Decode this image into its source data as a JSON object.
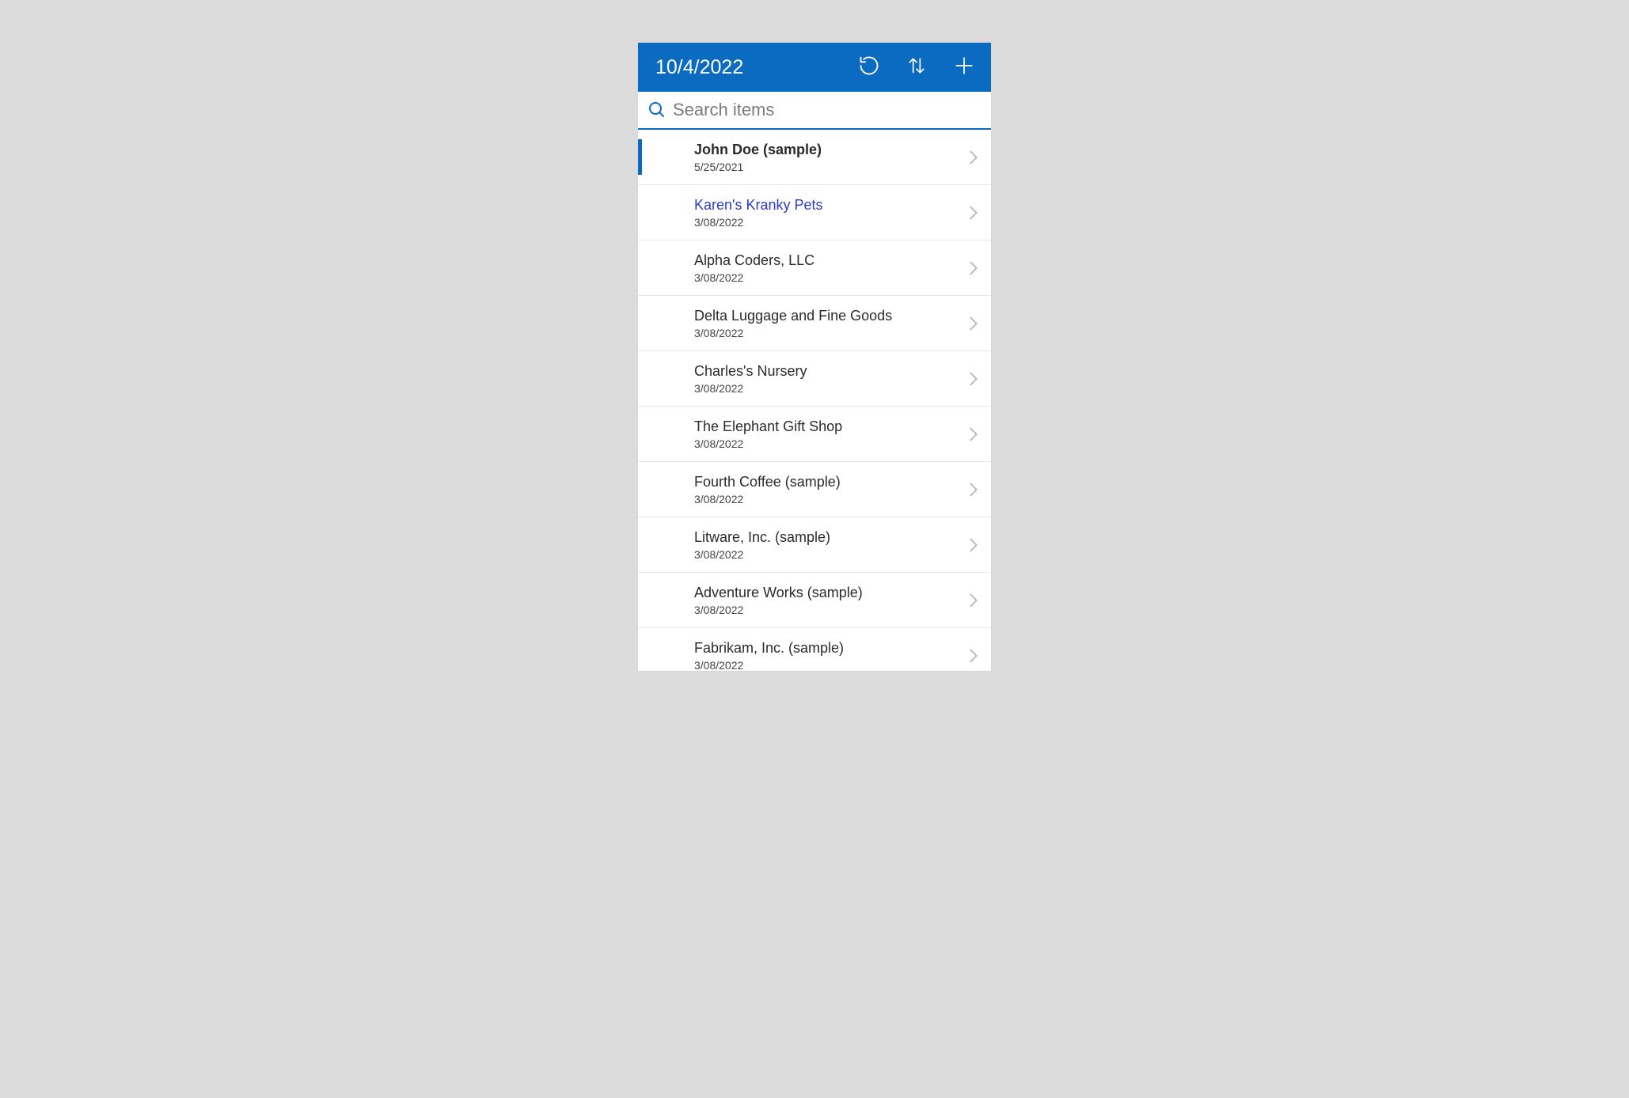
{
  "header": {
    "title": "10/4/2022"
  },
  "search": {
    "placeholder": "Search items",
    "value": ""
  },
  "items": [
    {
      "title": "John Doe (sample)",
      "date": "5/25/2021",
      "selected": true,
      "link": false
    },
    {
      "title": "Karen's Kranky Pets",
      "date": "3/08/2022",
      "selected": false,
      "link": true
    },
    {
      "title": "Alpha Coders, LLC",
      "date": "3/08/2022",
      "selected": false,
      "link": false
    },
    {
      "title": "Delta Luggage and Fine Goods",
      "date": "3/08/2022",
      "selected": false,
      "link": false
    },
    {
      "title": "Charles's Nursery",
      "date": "3/08/2022",
      "selected": false,
      "link": false
    },
    {
      "title": "The Elephant Gift Shop",
      "date": "3/08/2022",
      "selected": false,
      "link": false
    },
    {
      "title": "Fourth Coffee (sample)",
      "date": "3/08/2022",
      "selected": false,
      "link": false
    },
    {
      "title": "Litware, Inc. (sample)",
      "date": "3/08/2022",
      "selected": false,
      "link": false
    },
    {
      "title": "Adventure Works (sample)",
      "date": "3/08/2022",
      "selected": false,
      "link": false
    },
    {
      "title": "Fabrikam, Inc. (sample)",
      "date": "3/08/2022",
      "selected": false,
      "link": false
    }
  ]
}
